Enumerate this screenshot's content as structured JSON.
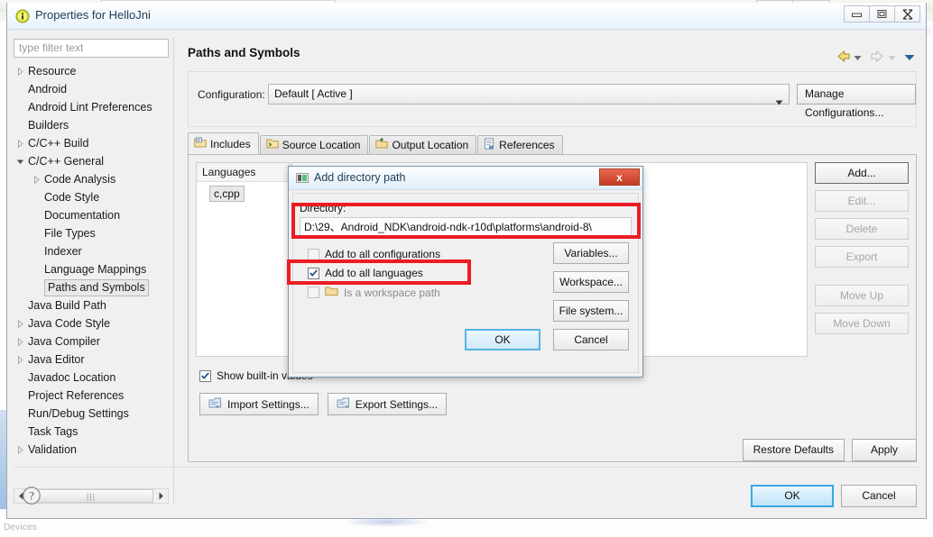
{
  "window": {
    "title": "Properties for HelloJni",
    "title_icon": "info-warning-icon",
    "buttons": {
      "minimize": "minimize-icon",
      "maximize": "maximize-icon",
      "close": "close-icon"
    }
  },
  "sidebar": {
    "filter_placeholder": "type filter text",
    "filter_value": "",
    "items": [
      {
        "label": "Resource",
        "indent": 0,
        "twisty": "collapsed",
        "selected": false
      },
      {
        "label": "Android",
        "indent": 0,
        "twisty": "none",
        "selected": false
      },
      {
        "label": "Android Lint Preferences",
        "indent": 0,
        "twisty": "none",
        "selected": false
      },
      {
        "label": "Builders",
        "indent": 0,
        "twisty": "none",
        "selected": false
      },
      {
        "label": "C/C++ Build",
        "indent": 0,
        "twisty": "collapsed",
        "selected": false
      },
      {
        "label": "C/C++ General",
        "indent": 0,
        "twisty": "expanded",
        "selected": false
      },
      {
        "label": "Code Analysis",
        "indent": 1,
        "twisty": "collapsed",
        "selected": false
      },
      {
        "label": "Code Style",
        "indent": 1,
        "twisty": "none",
        "selected": false
      },
      {
        "label": "Documentation",
        "indent": 1,
        "twisty": "none",
        "selected": false
      },
      {
        "label": "File Types",
        "indent": 1,
        "twisty": "none",
        "selected": false
      },
      {
        "label": "Indexer",
        "indent": 1,
        "twisty": "none",
        "selected": false
      },
      {
        "label": "Language Mappings",
        "indent": 1,
        "twisty": "none",
        "selected": false
      },
      {
        "label": "Paths and Symbols",
        "indent": 1,
        "twisty": "none",
        "selected": true
      },
      {
        "label": "Java Build Path",
        "indent": 0,
        "twisty": "none",
        "selected": false
      },
      {
        "label": "Java Code Style",
        "indent": 0,
        "twisty": "collapsed",
        "selected": false
      },
      {
        "label": "Java Compiler",
        "indent": 0,
        "twisty": "collapsed",
        "selected": false
      },
      {
        "label": "Java Editor",
        "indent": 0,
        "twisty": "collapsed",
        "selected": false
      },
      {
        "label": "Javadoc Location",
        "indent": 0,
        "twisty": "none",
        "selected": false
      },
      {
        "label": "Project References",
        "indent": 0,
        "twisty": "none",
        "selected": false
      },
      {
        "label": "Run/Debug Settings",
        "indent": 0,
        "twisty": "none",
        "selected": false
      },
      {
        "label": "Task Tags",
        "indent": 0,
        "twisty": "none",
        "selected": false
      },
      {
        "label": "Validation",
        "indent": 0,
        "twisty": "collapsed",
        "selected": false
      }
    ]
  },
  "page": {
    "title": "Paths and Symbols",
    "nav": {
      "back_icon": "back-arrow-icon",
      "back_menu_icon": "chevron-down-icon",
      "forward_icon": "forward-arrow-icon",
      "forward_menu_icon": "chevron-down-icon",
      "menu_icon": "chevron-down-icon"
    },
    "configuration": {
      "label": "Configuration:",
      "value": "Default  [ Active ]",
      "dropdown_icon": "chevron-down-icon",
      "manage_button": "Manage Configurations..."
    },
    "tabs": [
      {
        "label": "Includes",
        "icon": "includes-icon",
        "active": true
      },
      {
        "label": "Source Location",
        "icon": "source-folder-icon",
        "active": false
      },
      {
        "label": "Output Location",
        "icon": "output-folder-icon",
        "active": false
      },
      {
        "label": "References",
        "icon": "references-icon",
        "active": false
      }
    ],
    "languages": {
      "header": "Languages",
      "items": [
        "c,cpp"
      ]
    },
    "side_buttons": [
      {
        "label": "Add...",
        "state": "default"
      },
      {
        "label": "Edit...",
        "state": "disabled"
      },
      {
        "label": "Delete",
        "state": "disabled"
      },
      {
        "label": "Export",
        "state": "disabled"
      },
      {
        "label": "Move Up",
        "state": "disabled"
      },
      {
        "label": "Move Down",
        "state": "disabled"
      }
    ],
    "show_builtin": {
      "label": "Show built-in values",
      "checked": true
    },
    "settings_buttons": [
      {
        "label": "Import Settings...",
        "icon": "import-settings-icon"
      },
      {
        "label": "Export Settings...",
        "icon": "export-settings-icon"
      }
    ],
    "footer": {
      "restore_defaults": "Restore Defaults",
      "apply": "Apply",
      "help_icon": "help-question-icon",
      "ok": "OK",
      "cancel": "Cancel"
    }
  },
  "dialog": {
    "title": "Add directory path",
    "title_icon": "folder-path-icon",
    "close_label": "x",
    "directory_label": "Directory:",
    "directory_value": "D:\\29、Android_NDK\\android-ndk-r10d\\platforms\\android-8\\",
    "checkboxes": [
      {
        "label": "Add to all configurations",
        "checked": false,
        "enabled": false,
        "icon": "none"
      },
      {
        "label": "Add to all languages",
        "checked": true,
        "enabled": true,
        "icon": "none"
      },
      {
        "label": "Is a workspace path",
        "checked": false,
        "enabled": false,
        "icon": "folder-icon"
      }
    ],
    "side_buttons": [
      "Variables...",
      "Workspace...",
      "File system..."
    ],
    "ok": "OK",
    "cancel": "Cancel"
  },
  "annotations": [
    {
      "name": "highlight-directory-field",
      "color": "#ec1c24"
    },
    {
      "name": "highlight-add-to-all-languages",
      "color": "#ec1c24"
    }
  ],
  "backdrop": {
    "status_text": "Devices"
  }
}
